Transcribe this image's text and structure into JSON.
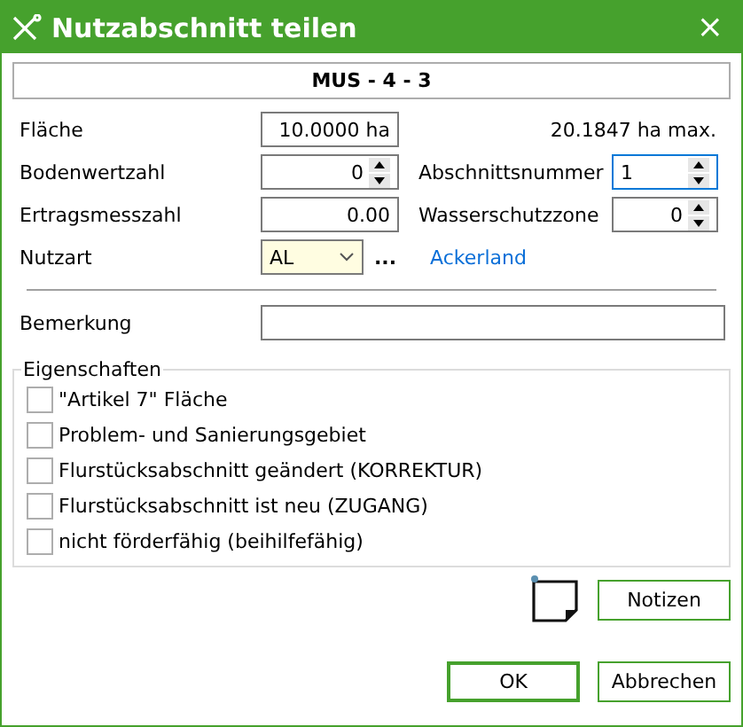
{
  "window": {
    "title": "Nutzabschnitt teilen",
    "close": "×"
  },
  "header": "MUS - 4 - 3",
  "flaeche": {
    "label": "Fläche",
    "value": "10.0000 ha",
    "max": "20.1847 ha max."
  },
  "bodenwertzahl": {
    "label": "Bodenwertzahl",
    "value": "0"
  },
  "abschnittsnummer": {
    "label": "Abschnittsnummer",
    "value": "1",
    "focused": true
  },
  "ertragsmesszahl": {
    "label": "Ertragsmesszahl",
    "value": "0.00"
  },
  "wasserschutzzone": {
    "label": "Wasserschutzzone",
    "value": "0"
  },
  "nutzart": {
    "label": "Nutzart",
    "value": "AL",
    "more": "...",
    "link": "Ackerland"
  },
  "bemerkung": {
    "label": "Bemerkung"
  },
  "eigenschaften": {
    "title": "Eigenschaften",
    "items": [
      {
        "label": "\"Artikel 7\" Fläche",
        "checked": false
      },
      {
        "label": "Problem- und Sanierungsgebiet",
        "checked": false
      },
      {
        "label": "Flurstücksabschnitt geändert (KORREKTUR)",
        "checked": false
      },
      {
        "label": "Flurstücksabschnitt ist neu (ZUGANG)",
        "checked": false
      },
      {
        "label": "nicht förderfähig (beihilfefähig)",
        "checked": false
      }
    ]
  },
  "buttons": {
    "notes": "Notizen",
    "ok": "OK",
    "cancel": "Abbrechen"
  }
}
